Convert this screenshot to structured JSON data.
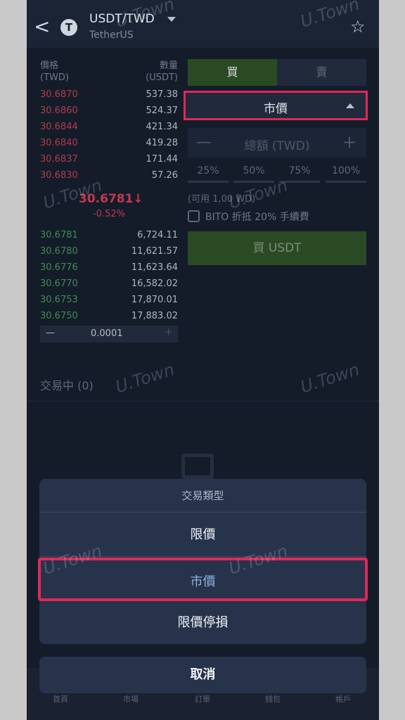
{
  "header": {
    "back": "<",
    "coin_icon": "T",
    "pair": "USDT/TWD",
    "pair_sub": "TetherUS",
    "star": "☆"
  },
  "orderbook": {
    "price_label": "價格",
    "price_unit": "(TWD)",
    "qty_label": "數量",
    "qty_unit": "(USDT)",
    "asks": [
      {
        "price": "30.6870",
        "qty": "537.38"
      },
      {
        "price": "30.6860",
        "qty": "524.37"
      },
      {
        "price": "30.6844",
        "qty": "421.34"
      },
      {
        "price": "30.6840",
        "qty": "419.28"
      },
      {
        "price": "30.6837",
        "qty": "171.44"
      },
      {
        "price": "30.6830",
        "qty": "57.26"
      }
    ],
    "last_price": "30.6781↓",
    "change": "-0.52%",
    "bids": [
      {
        "price": "30.6781",
        "qty": "6,724.11"
      },
      {
        "price": "30.6780",
        "qty": "11,621.57"
      },
      {
        "price": "30.6776",
        "qty": "11,623.64"
      },
      {
        "price": "30.6770",
        "qty": "16,582.02"
      },
      {
        "price": "30.6753",
        "qty": "17,870.01"
      },
      {
        "price": "30.6750",
        "qty": "17,883.02"
      }
    ],
    "step_minus": "—",
    "step_value": "0.0001",
    "step_plus": "+"
  },
  "order_form": {
    "buy_tab": "買",
    "sell_tab": "賣",
    "order_type": "市價",
    "amount_minus": "—",
    "amount_placeholder": "總額 (TWD)",
    "amount_plus": "+",
    "percents": [
      "25%",
      "50%",
      "75%",
      "100%"
    ],
    "available": "(可用 1,00  WD)",
    "bito_label": "BITO 折抵 20% 手續費",
    "buy_button": "買 USDT"
  },
  "trading": {
    "label": "交易中 (0)"
  },
  "nav": {
    "items": [
      "首頁",
      "市場",
      "訂單",
      "錢包",
      "帳戶"
    ]
  },
  "sheet": {
    "title": "交易類型",
    "options": [
      "限價",
      "市價",
      "限價停損"
    ],
    "selected_index": 1,
    "cancel": "取消"
  },
  "watermark": "U.Town",
  "colors": {
    "highlight": "#e0285a",
    "ask": "#b53a4a",
    "bid": "#3f8c52",
    "buy": "#2a4a24",
    "sheet": "#26334a"
  }
}
